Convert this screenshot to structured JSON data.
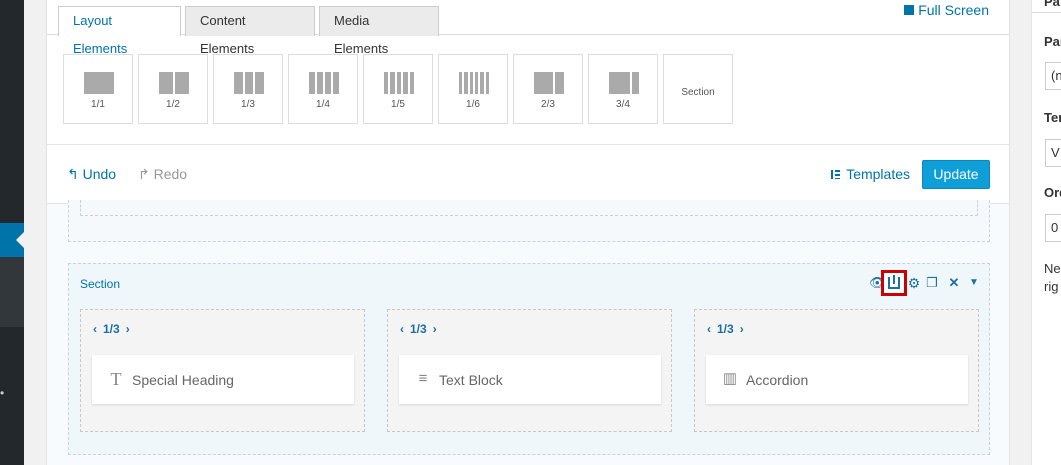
{
  "tabs": [
    "Layout Elements",
    "Content Elements",
    "Media Elements"
  ],
  "fullscreen": "Full Screen",
  "layouts": [
    {
      "label": "1/1",
      "cols": 1
    },
    {
      "label": "1/2",
      "cols": 2
    },
    {
      "label": "1/3",
      "cols": 3
    },
    {
      "label": "1/4",
      "cols": 4
    },
    {
      "label": "1/5",
      "cols": 5
    },
    {
      "label": "1/6",
      "cols": 6
    },
    {
      "label": "2/3",
      "cols": 2
    },
    {
      "label": "3/4",
      "cols": 2
    },
    {
      "label": "Section",
      "cols": 0
    }
  ],
  "toolbar": {
    "undo": "Undo",
    "redo": "Redo",
    "templates": "Templates",
    "update": "Update"
  },
  "section": {
    "title": "Section",
    "columns": [
      {
        "size": "1/3",
        "element": "Special Heading",
        "icon": "heading-icon"
      },
      {
        "size": "1/3",
        "element": "Text Block",
        "icon": "text-block-icon"
      },
      {
        "size": "1/3",
        "element": "Accordion",
        "icon": "accordion-icon"
      }
    ]
  },
  "right_panel": {
    "label1": "Pa",
    "label2": "Par",
    "field1": "(n",
    "label3": "Ter",
    "field2": "V",
    "label4": "Ord",
    "field3": "0",
    "note1": "Ne",
    "note2": "rig"
  },
  "colors": {
    "accent": "#0073aa",
    "update": "#0e9fd8",
    "highlight": "#cc0000"
  }
}
